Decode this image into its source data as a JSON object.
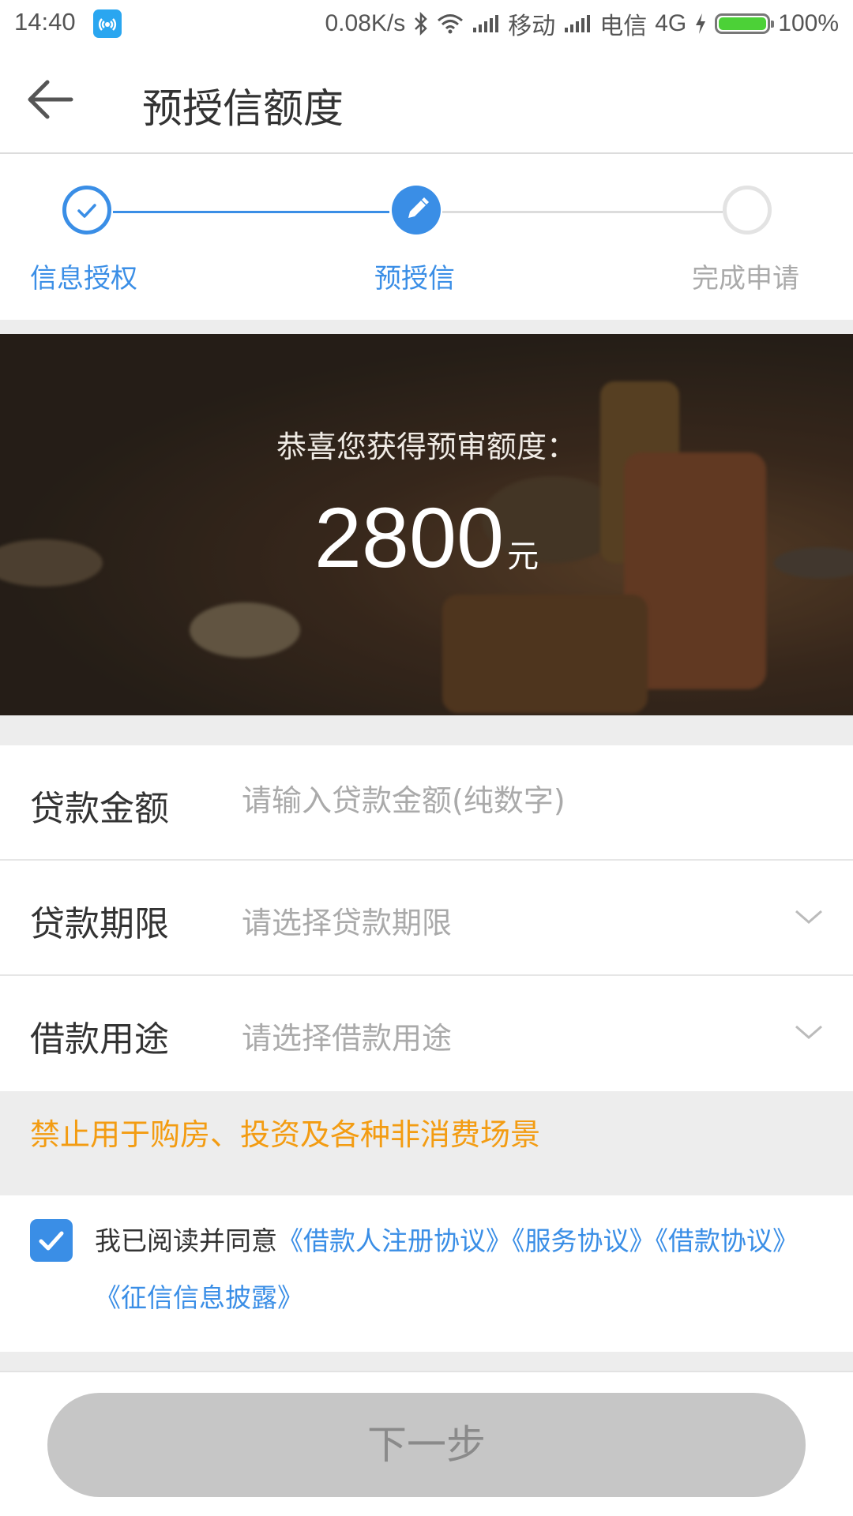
{
  "status_bar": {
    "time": "14:40",
    "speed": "0.08K/s",
    "carrier1": "移动",
    "carrier2": "电信",
    "network": "4G",
    "battery_level": 100,
    "battery": "100%"
  },
  "header": {
    "title": "预授信额度"
  },
  "steps": [
    {
      "label": "信息授权",
      "state": "done"
    },
    {
      "label": "预授信",
      "state": "current"
    },
    {
      "label": "完成申请",
      "state": "pending"
    }
  ],
  "banner": {
    "subtitle": "恭喜您获得预审额度：",
    "amount": "2800",
    "unit": "元"
  },
  "form": {
    "loan_amount": {
      "label": "贷款金额",
      "placeholder": "请输入贷款金额(纯数字)"
    },
    "loan_term": {
      "label": "贷款期限",
      "placeholder": "请选择贷款期限"
    },
    "loan_purpose": {
      "label": "借款用途",
      "placeholder": "请选择借款用途"
    }
  },
  "notice": "禁止用于购房、投资及各种非消费场景",
  "agreement": {
    "checked": true,
    "prefix": "我已阅读并同意",
    "links": [
      "《借款人注册协议》",
      "《服务协议》",
      "《借款协议》",
      "《征信信息披露》"
    ]
  },
  "next_button": "下一步",
  "colors": {
    "accent": "#3a8ee6",
    "warning": "#f39c12",
    "disabled_button": "#c6c6c6"
  }
}
